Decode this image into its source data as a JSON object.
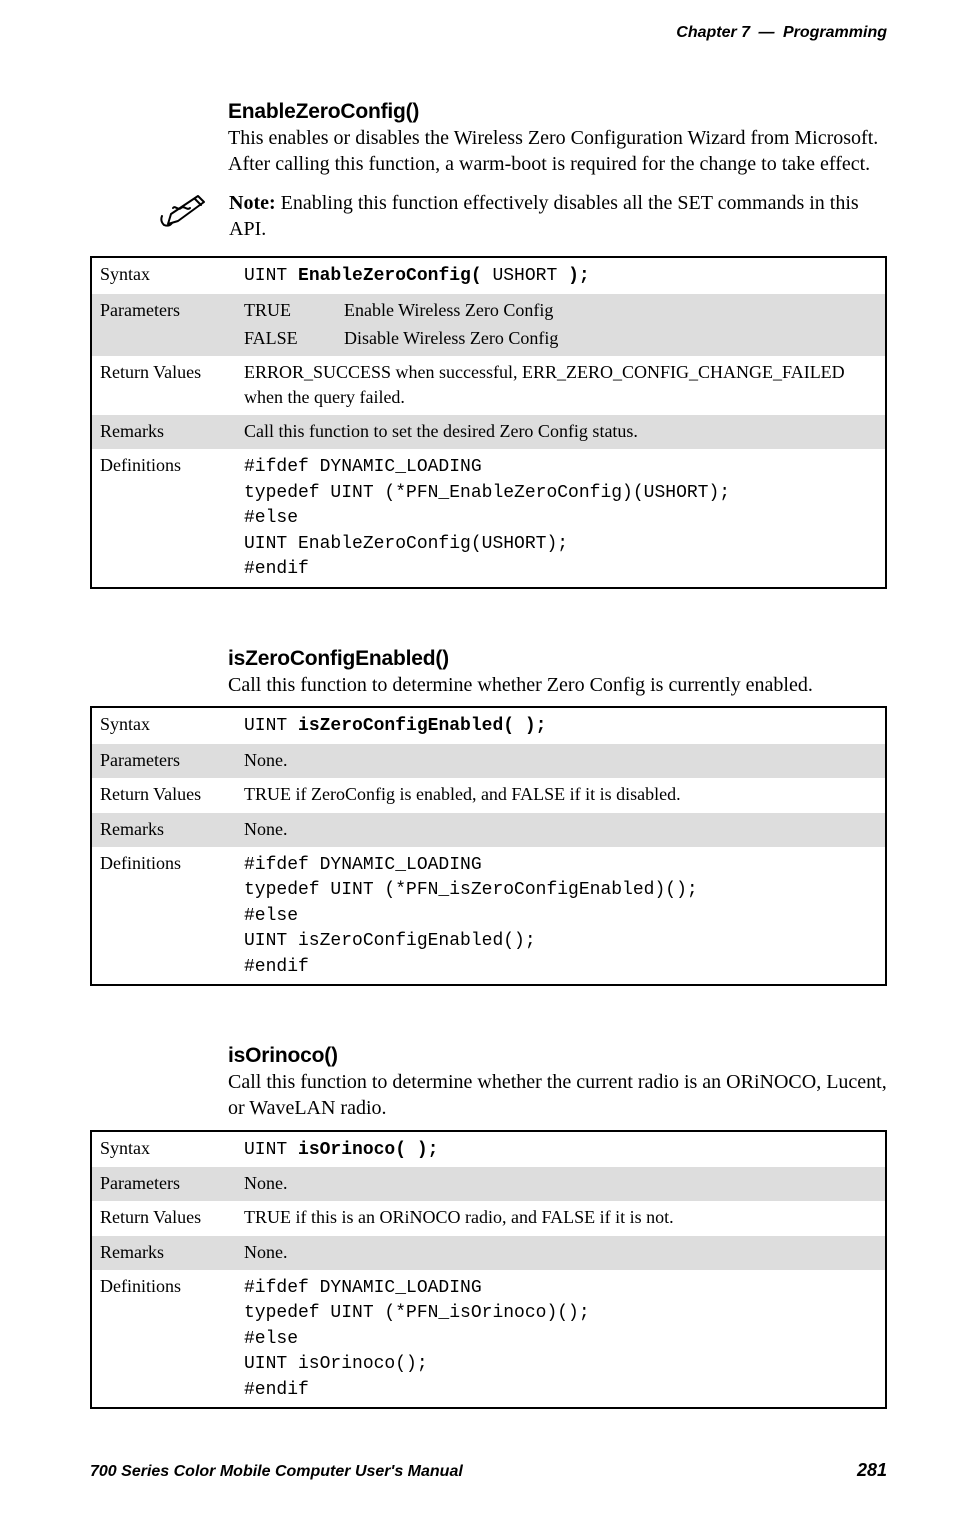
{
  "header": {
    "chapter_label": "Chapter",
    "chapter_num": "7",
    "separator": "—",
    "section_title": "Programming"
  },
  "sections": [
    {
      "title": "EnableZeroConfig()",
      "description": "This enables or disables the Wireless Zero Configuration Wizard from Microsoft. After calling this function, a warm-boot is required for the change to take effect.",
      "note": {
        "label": "Note:",
        "text": " Enabling this function effectively disables all the SET commands in this API."
      },
      "table": {
        "syntax_label": "Syntax",
        "syntax_ret": "UINT ",
        "syntax_sig": "EnableZeroConfig( ",
        "syntax_args": "USHORT ",
        "syntax_close": ");",
        "params_label": "Parameters",
        "params": [
          {
            "key": "TRUE",
            "desc": "Enable Wireless Zero Config"
          },
          {
            "key": "FALSE",
            "desc": "Disable Wireless Zero Config"
          }
        ],
        "return_label": "Return Values",
        "return_text": "ERROR_SUCCESS when successful, ERR_ZERO_CONFIG_CHANGE_FAILED when the query failed.",
        "remarks_label": "Remarks",
        "remarks_text": "Call this function to set the desired Zero Config status.",
        "defs_label": "Definitions",
        "defs_code": "#ifdef DYNAMIC_LOADING\ntypedef UINT (*PFN_EnableZeroConfig)(USHORT);\n#else\nUINT EnableZeroConfig(USHORT);\n#endif"
      }
    },
    {
      "title": "isZeroConfigEnabled()",
      "description": "Call this function to determine whether Zero Config is currently enabled.",
      "table": {
        "syntax_label": "Syntax",
        "syntax_ret": "UINT ",
        "syntax_sig": "isZeroConfigEnabled( );",
        "params_label": "Parameters",
        "params_text": "None.",
        "return_label": "Return Values",
        "return_text": "TRUE if ZeroConfig is enabled, and FALSE if it is disabled.",
        "remarks_label": "Remarks",
        "remarks_text": "None.",
        "defs_label": "Definitions",
        "defs_code": "#ifdef DYNAMIC_LOADING\ntypedef UINT (*PFN_isZeroConfigEnabled)();\n#else\nUINT isZeroConfigEnabled();\n#endif"
      }
    },
    {
      "title": "isOrinoco()",
      "description": "Call this function to determine whether the current radio is an ORiNOCO, Lucent, or WaveLAN radio.",
      "table": {
        "syntax_label": "Syntax",
        "syntax_ret": "UINT ",
        "syntax_sig": "isOrinoco( );",
        "params_label": "Parameters",
        "params_text": "None.",
        "return_label": "Return Values",
        "return_text": "TRUE if this is an ORiNOCO radio, and FALSE if it is not.",
        "remarks_label": "Remarks",
        "remarks_text": "None.",
        "defs_label": "Definitions",
        "defs_code": "#ifdef DYNAMIC_LOADING\ntypedef UINT (*PFN_isOrinoco)();\n#else\nUINT isOrinoco();\n#endif"
      }
    }
  ],
  "footer": {
    "manual_title": "700 Series Color Mobile Computer User's Manual",
    "page_number": "281"
  }
}
